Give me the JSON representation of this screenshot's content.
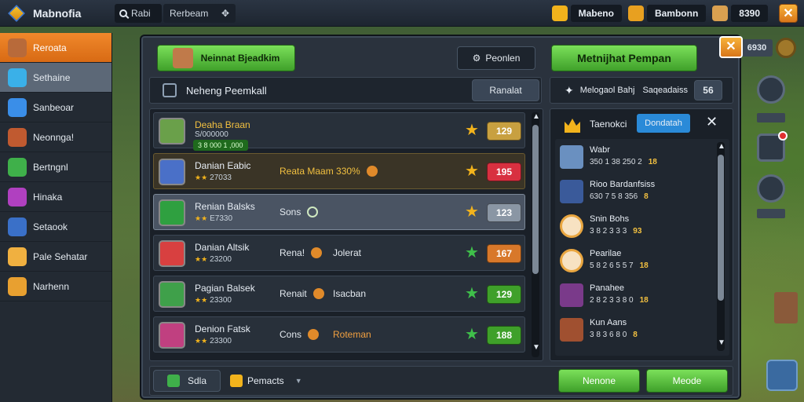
{
  "topbar": {
    "title": "Mabnofia",
    "search_label": "Rabi",
    "field_label": "Rerbeam",
    "resources": [
      {
        "icon": "gold-coin-icon",
        "value": "Mabeno",
        "color": "#f2b31c"
      },
      {
        "icon": "treasure-icon",
        "value": "Bambonn",
        "color": "#e8a020"
      },
      {
        "icon": "gem-icon",
        "value": "8390",
        "color": "#d9a050"
      }
    ]
  },
  "sidebar": {
    "items": [
      {
        "label": "Reroata",
        "icon": "hero-avatar-icon",
        "color": "#b86a3a",
        "state": "active"
      },
      {
        "label": "Sethaine",
        "icon": "diamond-icon",
        "color": "#3ab0e8",
        "state": "hover"
      },
      {
        "label": "Sanbeoar",
        "icon": "chat-icon",
        "color": "#3a8ee8",
        "state": ""
      },
      {
        "label": "Neonnga!",
        "icon": "warrior-icon",
        "color": "#c05a30",
        "state": ""
      },
      {
        "label": "Bertngnl",
        "icon": "shield-icon",
        "color": "#3fb04a",
        "state": ""
      },
      {
        "label": "Hinaka",
        "icon": "magic-icon",
        "color": "#b040c0",
        "state": ""
      },
      {
        "label": "Setaook",
        "icon": "book-icon",
        "color": "#3a70c8",
        "state": ""
      },
      {
        "label": "Pale Sehatar",
        "icon": "hand-icon",
        "color": "#f0b040",
        "state": ""
      },
      {
        "label": "Narhenn",
        "icon": "scroll-icon",
        "color": "#e8a030",
        "state": ""
      }
    ]
  },
  "panel": {
    "top_left_button": "Neinnat Bjeadkim",
    "filter_button": "Peonlen",
    "top_right_button": "Metnijhat Pempan",
    "list_title": "Neheng Peemkall",
    "list_action": "Ranalat",
    "right_head_title": "Melogaol Bahj",
    "right_head_sub": "Saqeadaiss",
    "right_head_count": "56",
    "bottom_left": "Sdla",
    "bottom_mid": "Pemacts",
    "bottom_btn_1": "Nenone",
    "bottom_btn_2": "Meode"
  },
  "rows": [
    {
      "name": "Deaha Braan",
      "sub": "S/000000",
      "badge": "3 8 000 1 ,000",
      "act": "",
      "act2": "",
      "star_color": "#f2b31c",
      "value": "129",
      "pill_color": "#c8a040",
      "avatar_color": "#6aa04a",
      "style": "normal"
    },
    {
      "name": "Danian Eabic",
      "sub": "27033",
      "badge": "",
      "act": "Reata Maam 330%",
      "act2": "",
      "star_color": "#f2b31c",
      "value": "195",
      "pill_color": "#d83040",
      "avatar_color": "#4a70c8",
      "style": "gold"
    },
    {
      "name": "Renian Balsks",
      "sub": "E7330",
      "badge": "",
      "act": "Sons",
      "act2": "",
      "star_color": "#f2b31c",
      "value": "123",
      "pill_color": "#8a96a4",
      "avatar_color": "#2fa040",
      "style": "sel"
    },
    {
      "name": "Danian Altsik",
      "sub": "23200",
      "badge": "",
      "act": "Rena!",
      "act2": "Jolerat",
      "star_color": "#3fc04a",
      "value": "167",
      "pill_color": "#d8782a",
      "avatar_color": "#d84040",
      "style": "normal"
    },
    {
      "name": "Pagian Balsek",
      "sub": "23300",
      "badge": "",
      "act": "Renait",
      "act2": "Isacban",
      "star_color": "#3fc04a",
      "value": "129",
      "pill_color": "#3fa02a",
      "avatar_color": "#3fa04a",
      "style": "normal"
    },
    {
      "name": "Denion Fatsk",
      "sub": "23300",
      "badge": "",
      "act": "Cons",
      "act2": "Roteman",
      "star_color": "#3fc04a",
      "value": "188",
      "pill_color": "#3fa02a",
      "avatar_color": "#c04080",
      "style": "normal"
    }
  ],
  "right_panel": {
    "title": "Taenokci",
    "tab": "Dondatah",
    "entries": [
      {
        "name": "Wabr",
        "sub": "350 1 38 250 2",
        "value": "18",
        "ava": "sword-avatar-icon",
        "color": "#6a90c0",
        "round": false
      },
      {
        "name": "Rioo Bardanfsiss",
        "sub": "630 7 5 8 356",
        "value": "8",
        "ava": "knight-avatar-icon",
        "color": "#3a5a9a",
        "round": false
      },
      {
        "name": "Snin Bohs",
        "sub": "3 8 2 3 3 3",
        "value": "93",
        "ava": "skull-avatar-icon",
        "color": "#f7e2c2",
        "round": true
      },
      {
        "name": "Pearilae",
        "sub": "5 8 2 6 5 5 7",
        "value": "18",
        "ava": "skull-avatar-icon",
        "color": "#f7e2c2",
        "round": true
      },
      {
        "name": "Panahee",
        "sub": "2 8 2 3 3 8 0",
        "value": "18",
        "ava": "mage-avatar-icon",
        "color": "#7a3a8a",
        "round": false
      },
      {
        "name": "Kun Aans",
        "sub": "3 8 3 6 8 0",
        "value": "8",
        "ava": "warrior-avatar-icon",
        "color": "#a05030",
        "round": false
      }
    ]
  },
  "world": {
    "score_label": "6930"
  }
}
